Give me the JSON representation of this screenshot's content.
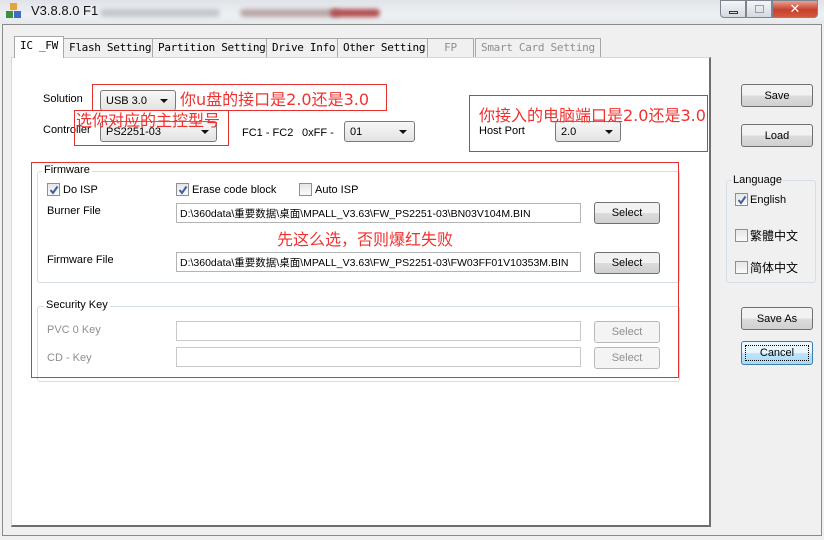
{
  "window": {
    "title": "V3.8.8.0 F1",
    "controls": {
      "minimize": "minimize-icon",
      "maximize": "maximize-icon",
      "close": "✕"
    }
  },
  "tabs": [
    {
      "label": "IC _FW",
      "state": "active"
    },
    {
      "label": "Flash Setting",
      "state": "normal"
    },
    {
      "label": "Partition Setting",
      "state": "normal"
    },
    {
      "label": "Drive Info",
      "state": "normal"
    },
    {
      "label": "Other Setting",
      "state": "normal"
    },
    {
      "label": "FP",
      "state": "disabled"
    },
    {
      "label": "Smart Card Setting",
      "state": "disabled"
    }
  ],
  "ic_fw": {
    "solution": {
      "label": "Solution",
      "value": "USB 3.0"
    },
    "controller": {
      "label": "Controller",
      "value": "PS2251-03"
    },
    "fc": {
      "label": "FC1 - FC2",
      "hex_label": "0xFF -",
      "value": "01"
    },
    "host_port": {
      "label": "Host Port",
      "value": "2.0"
    },
    "firmware": {
      "title": "Firmware",
      "do_isp": {
        "label": "Do ISP",
        "checked": true
      },
      "erase_code_block": {
        "label": "Erase code block",
        "checked": true
      },
      "auto_isp": {
        "label": "Auto ISP",
        "checked": false
      },
      "burner_file": {
        "label": "Burner File",
        "value": "D:\\360data\\重要数据\\桌面\\MPALL_V3.63\\FW_PS2251-03\\BN03V104M.BIN",
        "button": "Select"
      },
      "firmware_file": {
        "label": "Firmware File",
        "value": "D:\\360data\\重要数据\\桌面\\MPALL_V3.63\\FW_PS2251-03\\FW03FF01V10353M.BIN",
        "button": "Select"
      }
    },
    "security_key": {
      "title": "Security Key",
      "pvc0_key": {
        "label": "PVC 0 Key",
        "value": "",
        "button": "Select"
      },
      "cd_key": {
        "label": "CD - Key",
        "value": "",
        "button": "Select"
      }
    }
  },
  "sidebar": {
    "save": "Save",
    "load": "Load",
    "language": {
      "title": "Language",
      "options": [
        {
          "label": "English",
          "checked": true
        },
        {
          "label": "繁體中文",
          "checked": false
        },
        {
          "label": "简体中文",
          "checked": false
        }
      ]
    },
    "save_as": "Save As",
    "cancel": "Cancel"
  },
  "annotations": {
    "usb_interface": "你u盘的接口是2.0还是3.0",
    "controller_model": "选你对应的主控型号",
    "host_port": "你接入的电脑端口是2.0还是3.0",
    "firmware_hint": "先这么选，否则爆红失败"
  },
  "colors": {
    "annotation_red": "#f0312e",
    "default_button_blue": "#bee6fd",
    "close_button_red": "#c7412c"
  }
}
